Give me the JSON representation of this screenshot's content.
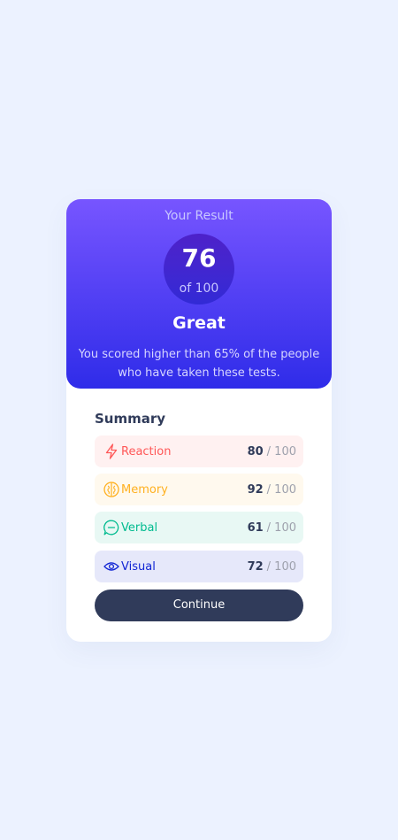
{
  "result": {
    "title": "Your Result",
    "score": "76",
    "score_of": "of 100",
    "rating": "Great",
    "description": "You scored higher than 65% of the people who have taken these tests."
  },
  "summary": {
    "title": "Summary",
    "items": [
      {
        "label": "Reaction",
        "score": "80",
        "max": "/ 100",
        "icon": "lightning-icon",
        "color": "#ff5757",
        "bg": "#fff1f1"
      },
      {
        "label": "Memory",
        "score": "92",
        "max": "/ 100",
        "icon": "brain-icon",
        "color": "#ffb01f",
        "bg": "#fff9ee"
      },
      {
        "label": "Verbal",
        "score": "61",
        "max": "/ 100",
        "icon": "chat-bubble-icon",
        "color": "#00bb8f",
        "bg": "#e8f8f4"
      },
      {
        "label": "Visual",
        "score": "72",
        "max": "/ 100",
        "icon": "eye-icon",
        "color": "#1125d4",
        "bg": "#e6e8fa"
      }
    ]
  },
  "actions": {
    "continue_label": "Continue"
  },
  "colors": {
    "page_background": "#ecf2ff",
    "gradient_top": "#7755ff",
    "gradient_bottom": "#2f2ce9",
    "button": "#303b5a"
  }
}
